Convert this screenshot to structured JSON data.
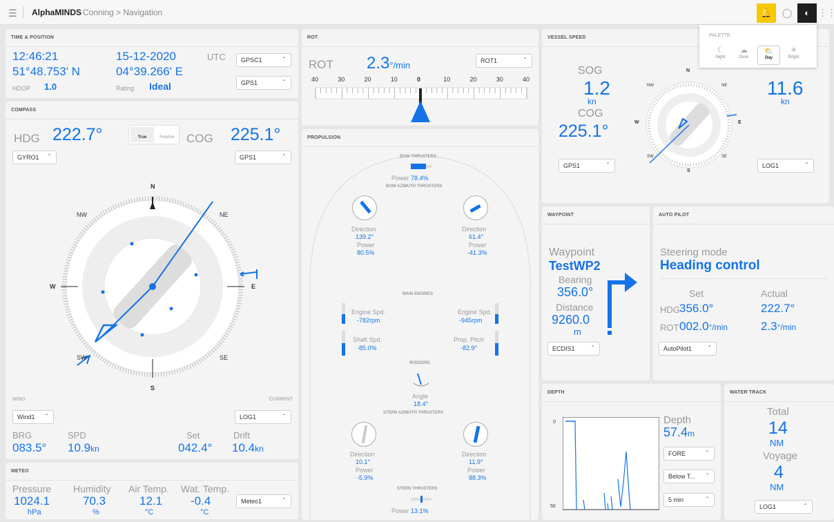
{
  "topbar": {
    "menu_icon": "hamburger-icon",
    "app_title": "AlphaMINDS",
    "breadcrumb": "Conning > Navigation"
  },
  "palette": {
    "title": "PALETTE",
    "options": [
      "Night",
      "Dusk",
      "Day",
      "Bright"
    ],
    "selected": "Day"
  },
  "time_position": {
    "title": "TIME & POSITION",
    "time": "12:46:21",
    "date": "15-12-2020",
    "tz": "UTC",
    "lat": "51°48.753' N",
    "lon": "04°39.266' E",
    "hdop_label": "HDOP",
    "hdop": "1.0",
    "rating_label": "Rating",
    "rating": "Ideal",
    "sel1": "GPSC1",
    "sel2": "GPS1"
  },
  "compass": {
    "title": "COMPASS",
    "hdg_label": "HDG",
    "hdg": "222.7°",
    "cog_label": "COG",
    "cog": "225.1°",
    "true_label": "True",
    "relative_label": "Relative",
    "sel_hdg": "GYRO1",
    "sel_cog": "GPS1",
    "north": "N",
    "south": "S",
    "east": "E",
    "west": "W",
    "ne": "NE",
    "nw": "NW",
    "se": "SE",
    "sw": "SW",
    "wind_label": "WIND",
    "current_label": "CURRENT",
    "wind_sel": "Wind1",
    "current_sel": "LOG1",
    "brg_label": "BRG",
    "brg": "083.5°",
    "spd_label": "SPD",
    "spd": "10.9",
    "spd_unit": "kn",
    "set_label": "Set",
    "set": "042.4°",
    "drift_label": "Drift",
    "drift": "10.4",
    "drift_unit": "kn"
  },
  "meteo": {
    "title": "METEO",
    "pressure_label": "Pressure",
    "pressure": "1024.1",
    "pressure_unit": "hPa",
    "humidity_label": "Humidity",
    "humidity": "70.3",
    "humidity_unit": "%",
    "air_label": "Air Temp.",
    "air": "12.1",
    "air_unit": "°C",
    "water_label": "Wat. Temp.",
    "water": "-0.4",
    "water_unit": "°C",
    "sel": "Meteo1"
  },
  "rot": {
    "title": "ROT",
    "label": "ROT",
    "value": "2.3",
    "unit": "°/min",
    "sel": "ROT1",
    "ticks": [
      "40",
      "30",
      "20",
      "10",
      "0",
      "10",
      "20",
      "30",
      "40"
    ]
  },
  "propulsion": {
    "title": "PROPULSION",
    "bow_thrusters": "BOW THRUSTERS",
    "bow_power_label": "Power",
    "bow_power": "78.4%",
    "bow_azimuth": "BOW AZIMUTH THRUSTERS",
    "bow_az_left": {
      "dir_label": "Direction",
      "dir": "139.2°",
      "pow_label": "Power",
      "pow": "80.5%"
    },
    "bow_az_right": {
      "dir_label": "Direction",
      "dir": "61.4°",
      "pow_label": "Power",
      "pow": "-41.3%"
    },
    "main_engines": "MAIN ENGINES",
    "eng_left_label": "Engine Spd.",
    "eng_left": "-782",
    "eng_right_label": "Engine Spd.",
    "eng_right": "-945",
    "rpm": "rpm",
    "shaft_label": "Shaft Spd.",
    "shaft": "-85.0%",
    "pitch_label": "Prop. Pitch",
    "pitch": "-82.9°",
    "rudders": "RUDDERS",
    "angle_label": "Angle",
    "angle": "18.4°",
    "stern_azimuth": "STERN AZIMUTH THRUSTERS",
    "stern_az_left": {
      "dir_label": "Direction",
      "dir": "10.1°",
      "pow_label": "Power",
      "pow": "-5.9%"
    },
    "stern_az_right": {
      "dir_label": "Direction",
      "dir": "11.9°",
      "pow_label": "Power",
      "pow": "88.3%"
    },
    "stern_thrusters": "STERN THRUSTERS",
    "stern_power_label": "Power",
    "stern_power": "13.1%"
  },
  "vessel_speed": {
    "title": "VESSEL SPEED",
    "sog_label": "SOG",
    "sog": "1.2",
    "sog_unit": "kn",
    "cog_label": "COG",
    "cog": "225.1°",
    "stw": "11.6",
    "stw_unit": "kn",
    "sel_left": "GPS1",
    "sel_right": "LOG1",
    "n": "N",
    "s": "S",
    "e": "E",
    "w": "W",
    "ne": "NE",
    "nw": "NW",
    "se": "SE",
    "sw": "SW"
  },
  "waypoint": {
    "title": "WAYPOINT",
    "label": "Waypoint",
    "name": "TestWP2",
    "bearing_label": "Bearing",
    "bearing": "356.0°",
    "distance_label": "Distance",
    "distance": "9260.0",
    "distance_unit": "m",
    "sel": "ECDIS1"
  },
  "autopilot": {
    "title": "AUTO PILOT",
    "mode_label": "Steering mode",
    "mode": "Heading control",
    "set_label": "Set",
    "actual_label": "Actual",
    "hdg_label": "HDG",
    "hdg_set": "356.0°",
    "hdg_actual": "222.7°",
    "rot_label": "ROT",
    "rot_set": "002.0",
    "rot_actual": "2.3",
    "rot_unit": "°/min",
    "sel": "AutoPilot1"
  },
  "depth": {
    "title": "DEPTH",
    "label": "Depth",
    "value": "57.4",
    "unit": "m",
    "sel1": "FORE",
    "sel2": "Below T...",
    "sel3": "5 min",
    "axis_top": "0",
    "axis_bottom": "50"
  },
  "water_track": {
    "title": "WATER TRACK",
    "total_label": "Total",
    "total": "14",
    "total_unit": "NM",
    "voyage_label": "Voyage",
    "voyage": "4",
    "voyage_unit": "NM",
    "sel": "LOG1"
  },
  "colors": {
    "accent": "#1473e6",
    "bell": "#f5c800",
    "dark_button": "#1f1f1f"
  }
}
